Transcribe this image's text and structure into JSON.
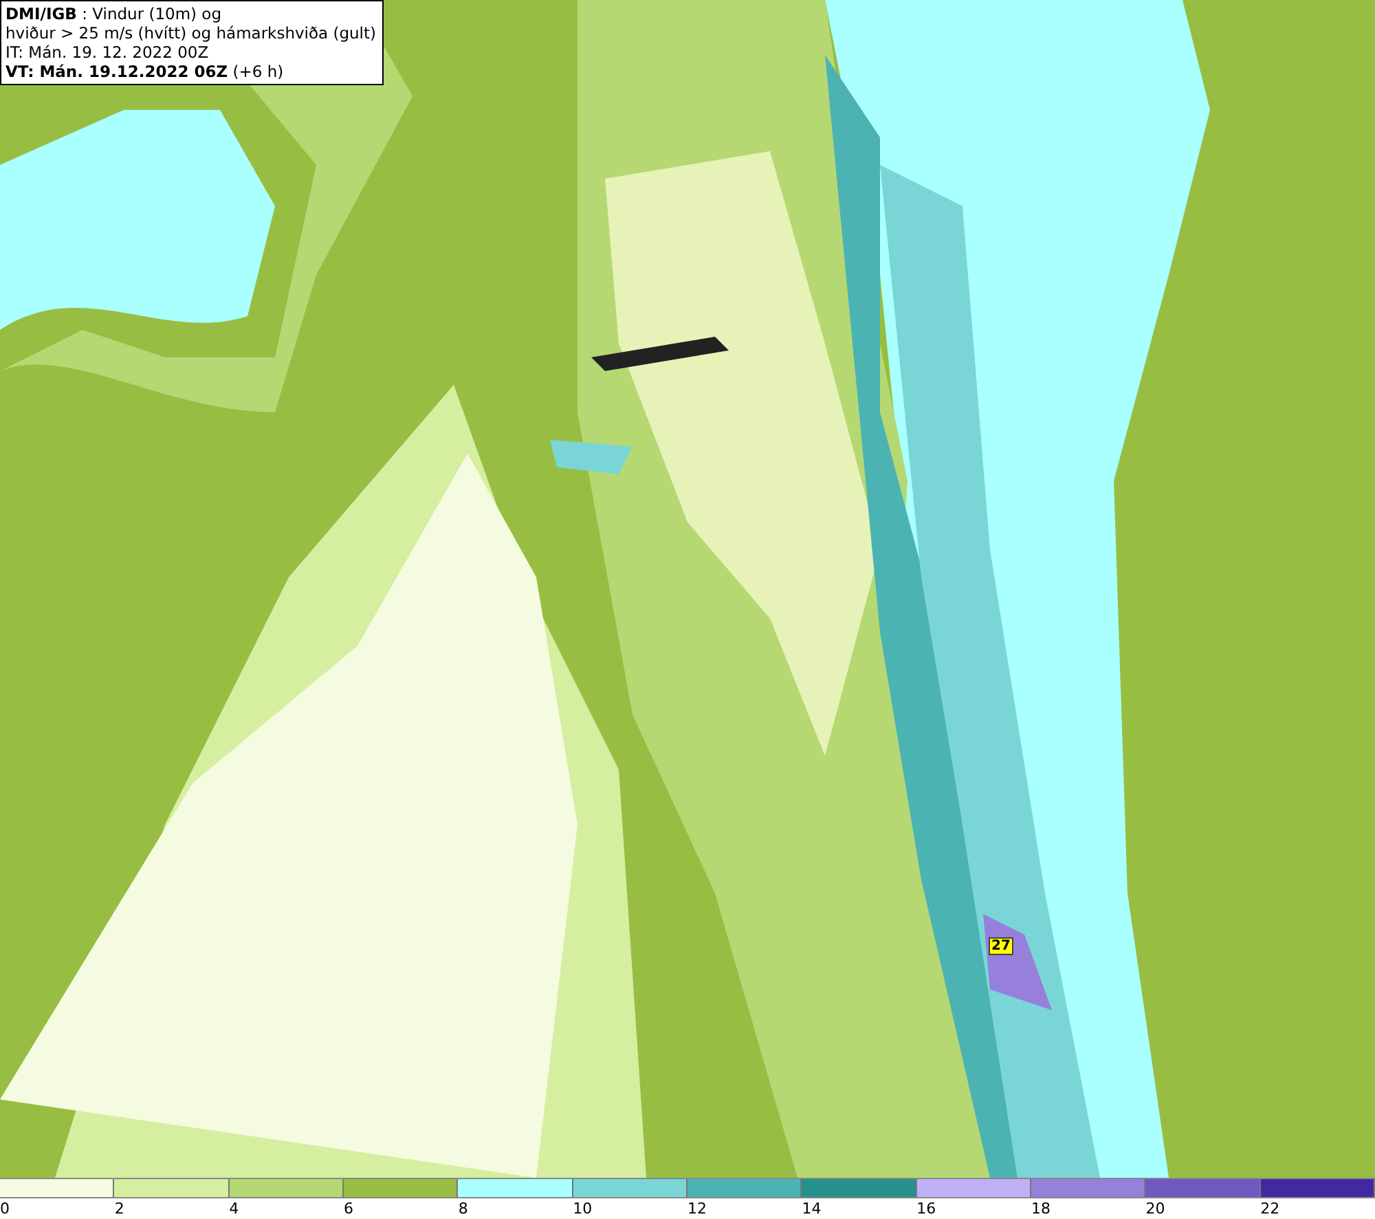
{
  "header": {
    "lines": [
      "**DMI/IGB** : Vindur (10m) og",
      "hviður > 25 m/s (hvítt) og hámarkshviða (gult)",
      "IT: Mán. 19. 12. 2022 00Z",
      "**VT: Mán. 19.12.2022 06Z** (+6 h)"
    ]
  },
  "map": {
    "gust_labels": [
      {
        "text": "27"
      }
    ]
  },
  "legend": {
    "segments": [
      {
        "label": "0",
        "color": "#f5fbe0"
      },
      {
        "label": "2",
        "color": "#d6eea0"
      },
      {
        "label": "4",
        "color": "#b5d873"
      },
      {
        "label": "6",
        "color": "#97be43"
      },
      {
        "label": "8",
        "color": "#aaffff"
      },
      {
        "label": "10",
        "color": "#7ad6d6"
      },
      {
        "label": "12",
        "color": "#4cb3b3"
      },
      {
        "label": "14",
        "color": "#26918c"
      },
      {
        "label": "16",
        "color": "#c0b0f8"
      },
      {
        "label": "18",
        "color": "#9680dc"
      },
      {
        "label": "20",
        "color": "#7058c0"
      },
      {
        "label": "22",
        "color": "#4428a0"
      }
    ]
  }
}
